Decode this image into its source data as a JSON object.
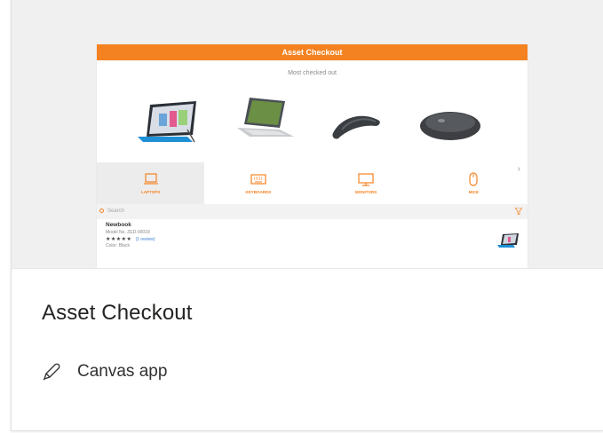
{
  "card": {
    "title": "Asset Checkout",
    "type_icon": "pen-icon",
    "type_label": "Canvas app"
  },
  "preview": {
    "header": "Asset Checkout",
    "subtitle": "Most checked out",
    "accent_color": "#f58220",
    "products": [
      {
        "icon": "surface-tablet-image"
      },
      {
        "icon": "laptop-image"
      },
      {
        "icon": "arc-mouse-image"
      },
      {
        "icon": "mouse-image"
      }
    ],
    "categories": [
      {
        "label": "LAPTOPS",
        "icon": "laptop-icon"
      },
      {
        "label": "KEYBOARDS",
        "icon": "keyboard-icon"
      },
      {
        "label": "MONITORS",
        "icon": "monitor-icon"
      },
      {
        "label": "MICE",
        "icon": "mouse-icon"
      }
    ],
    "search_placeholder": "Search",
    "list_item": {
      "name": "Newbook",
      "model": "Model No. ZED-00018",
      "stars": "★★★★★",
      "reviews": "(1 review)",
      "color": "Color: Black"
    }
  }
}
